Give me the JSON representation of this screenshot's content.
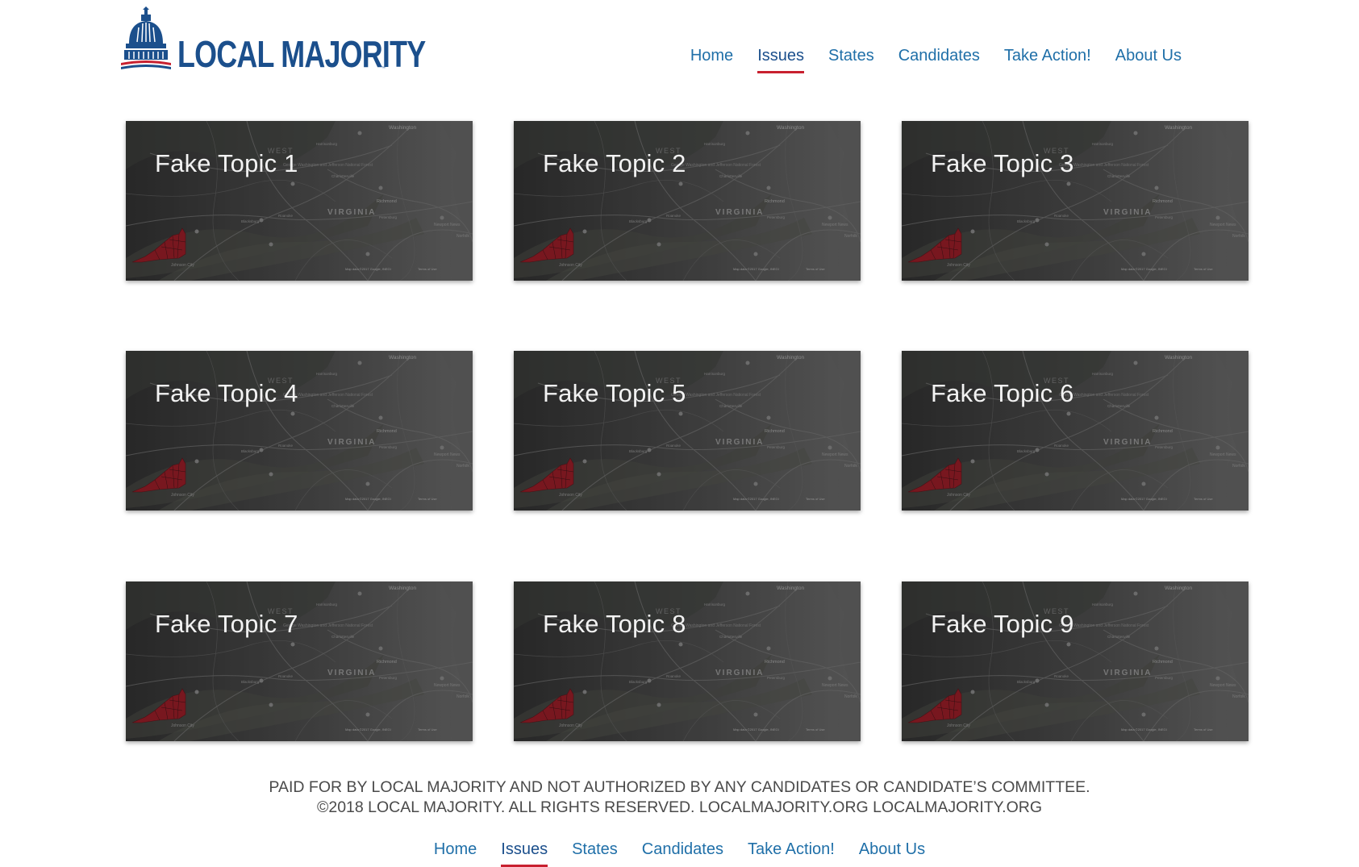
{
  "brand": {
    "name": "LOCAL MAJORITY",
    "trademark": "™"
  },
  "colors": {
    "brand_blue": "#1b4f8c",
    "link_blue": "#1f6fa8",
    "accent_red": "#c8202f",
    "card_overlay": "#3a3a3a"
  },
  "nav": {
    "items": [
      {
        "label": "Home",
        "active": false
      },
      {
        "label": "Issues",
        "active": true
      },
      {
        "label": "States",
        "active": false
      },
      {
        "label": "Candidates",
        "active": false
      },
      {
        "label": "Take Action!",
        "active": false
      },
      {
        "label": "About Us",
        "active": false
      }
    ]
  },
  "topics": [
    {
      "title": "Fake Topic 1"
    },
    {
      "title": "Fake Topic 2"
    },
    {
      "title": "Fake Topic 3"
    },
    {
      "title": "Fake Topic 4"
    },
    {
      "title": "Fake Topic 5"
    },
    {
      "title": "Fake Topic 6"
    },
    {
      "title": "Fake Topic 7"
    },
    {
      "title": "Fake Topic 8"
    },
    {
      "title": "Fake Topic 9"
    }
  ],
  "map_labels": {
    "state": "VIRGINIA",
    "region": "WEST",
    "cities": [
      "Washington",
      "Harrisonburg",
      "Charlottesville",
      "Richmond",
      "Petersburg",
      "Roanoke",
      "Blacksburg",
      "Newport News",
      "Norfolk",
      "Johnson City"
    ],
    "forest": "George Washington and Jefferson National Forest",
    "attribution": "Map data ©2017 Google, INEGI",
    "terms": "Terms of Use"
  },
  "footer": {
    "disclaimer_line1": "PAID FOR BY LOCAL MAJORITY AND NOT AUTHORIZED BY ANY CANDIDATES OR CANDIDATE’S COMMITTEE.",
    "disclaimer_line2": "©2018 LOCAL MAJORITY. ALL RIGHTS RESERVED. LOCALMAJORITY.ORG LOCALMAJORITY.ORG"
  }
}
